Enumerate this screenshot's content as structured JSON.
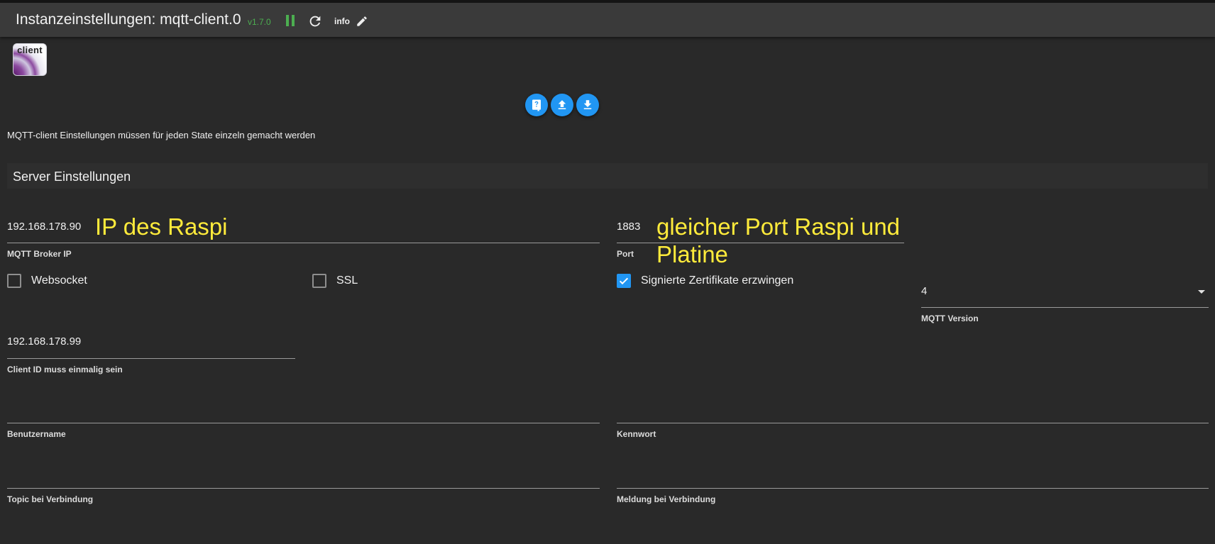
{
  "header": {
    "title": "Instanzeinstellungen: mqtt-client.0",
    "version": "v1.7.0",
    "info_label": "info"
  },
  "logo": {
    "text": "client"
  },
  "hint": "MQTT-client Einstellungen müssen für jeden State einzeln gemacht werden",
  "section": {
    "title": "Server Einstellungen"
  },
  "fields": {
    "broker_ip": {
      "value": "192.168.178.90",
      "label": "MQTT Broker IP"
    },
    "port": {
      "value": "1883",
      "label": "Port"
    },
    "client_id": {
      "value": "192.168.178.99",
      "label": "Client ID muss einmalig sein"
    },
    "mqtt_version": {
      "value": "4",
      "label": "MQTT Version"
    },
    "username": {
      "value": "",
      "label": "Benutzername"
    },
    "password": {
      "value": "",
      "label": "Kennwort"
    },
    "connect_topic": {
      "value": "",
      "label": "Topic bei Verbindung"
    },
    "connect_message": {
      "value": "",
      "label": "Meldung bei Verbindung"
    }
  },
  "checkboxes": {
    "websocket": {
      "label": "Websocket",
      "checked": false
    },
    "ssl": {
      "label": "SSL",
      "checked": false
    },
    "signed_certs": {
      "label": "Signierte Zertifikate erzwingen",
      "checked": true
    }
  },
  "annotations": {
    "ip": "IP des Raspi",
    "port_line1": "gleicher Port Raspi und",
    "port_line2": "Platine"
  },
  "colors": {
    "accent": "#2196f3",
    "running": "#4caf50",
    "annotation": "#ffeb3b"
  }
}
